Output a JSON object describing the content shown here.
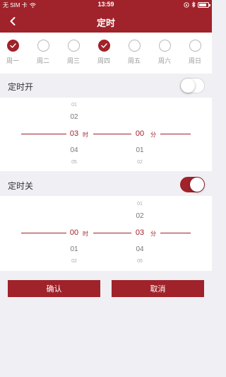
{
  "status_bar": {
    "carrier": "无 SIM 卡",
    "time": "13:59",
    "battery_level": 0.8
  },
  "navbar": {
    "title": "定时",
    "back_icon": "chevron-left-icon"
  },
  "week": {
    "days": [
      {
        "label": "周一",
        "checked": true
      },
      {
        "label": "周二",
        "checked": false
      },
      {
        "label": "周三",
        "checked": false
      },
      {
        "label": "周四",
        "checked": true
      },
      {
        "label": "周五",
        "checked": false
      },
      {
        "label": "周六",
        "checked": false
      },
      {
        "label": "周日",
        "checked": false
      }
    ]
  },
  "timer_on": {
    "label": "定时开",
    "enabled": false,
    "hour": {
      "values": [
        "01",
        "02",
        "03",
        "04",
        "05"
      ],
      "selected": "03",
      "unit": "时"
    },
    "minute": {
      "values": [
        "00",
        "01",
        "02"
      ],
      "selected": "00",
      "unit": "分"
    }
  },
  "timer_off": {
    "label": "定时关",
    "enabled": true,
    "hour": {
      "values": [
        "00",
        "01",
        "02"
      ],
      "selected": "00",
      "unit": "时"
    },
    "minute": {
      "values": [
        "01",
        "02",
        "03",
        "04",
        "05"
      ],
      "selected": "03",
      "unit": "分"
    }
  },
  "buttons": {
    "confirm": "确认",
    "cancel": "取消"
  },
  "colors": {
    "accent": "#a0222a",
    "background": "#efeff4"
  }
}
